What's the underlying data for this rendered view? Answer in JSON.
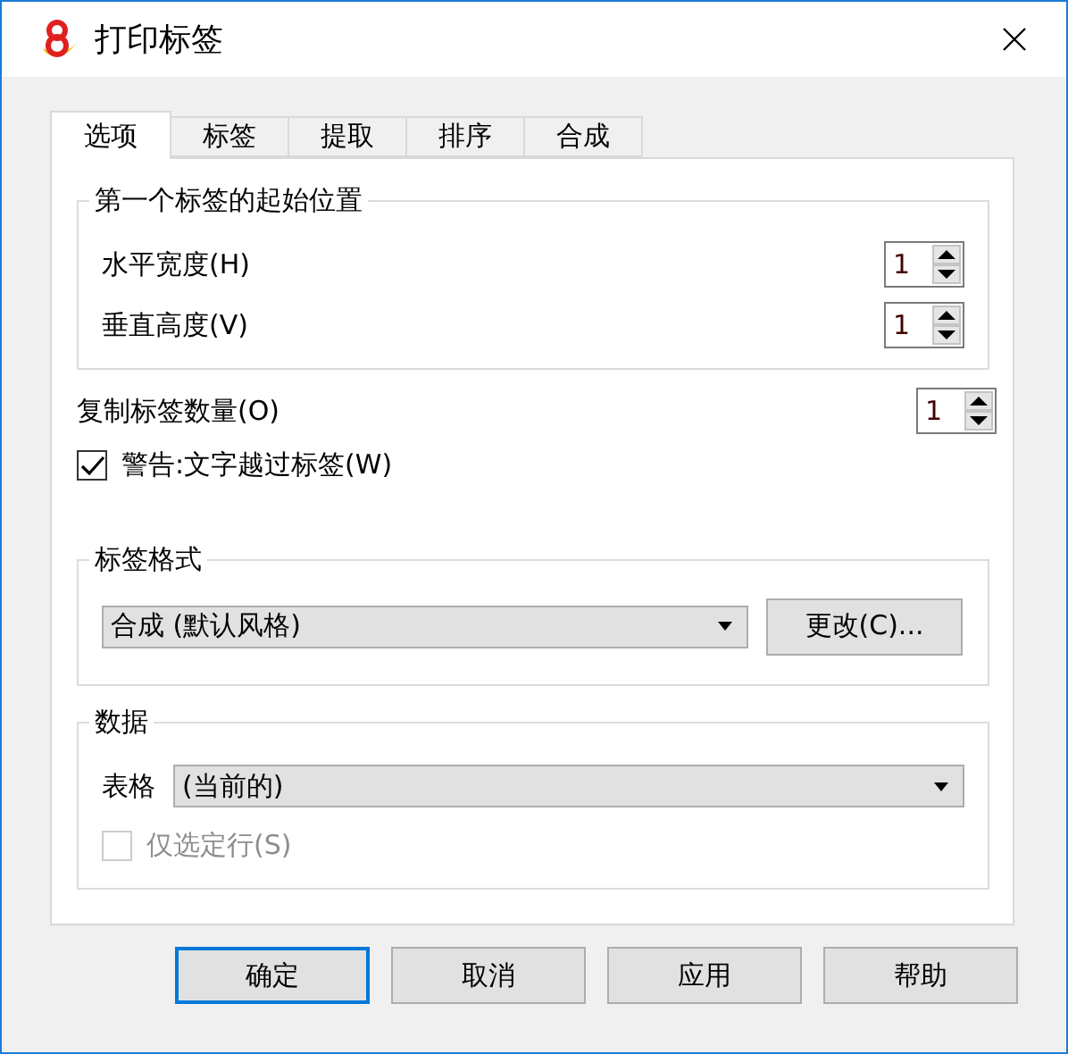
{
  "window": {
    "title": "打印标签"
  },
  "tabs": [
    {
      "label": "选项",
      "selected": true
    },
    {
      "label": "标签",
      "selected": false
    },
    {
      "label": "提取",
      "selected": false
    },
    {
      "label": "排序",
      "selected": false
    },
    {
      "label": "合成",
      "selected": false
    }
  ],
  "start_position": {
    "title": "第一个标签的起始位置",
    "fields": [
      {
        "label": "水平宽度(H)",
        "value": "1"
      },
      {
        "label": "垂直高度(V)",
        "value": "1"
      }
    ]
  },
  "copies": {
    "label": "复制标签数量(O)",
    "value": "1"
  },
  "warning_checkbox": {
    "label": "警告:文字越过标签(W)",
    "checked": true,
    "disabled": false
  },
  "label_format": {
    "title": "标签格式",
    "value": "合成 (默认风格)",
    "button": "更改(C)..."
  },
  "data": {
    "title": "数据",
    "table_label": "表格",
    "table_value": "(当前的)",
    "selected_only": {
      "label": "仅选定行(S)",
      "checked": false,
      "disabled": true
    }
  },
  "buttons": [
    {
      "label": "确定",
      "default": true
    },
    {
      "label": "取消",
      "default": false
    },
    {
      "label": "应用",
      "default": false
    },
    {
      "label": "帮助",
      "default": false
    }
  ]
}
